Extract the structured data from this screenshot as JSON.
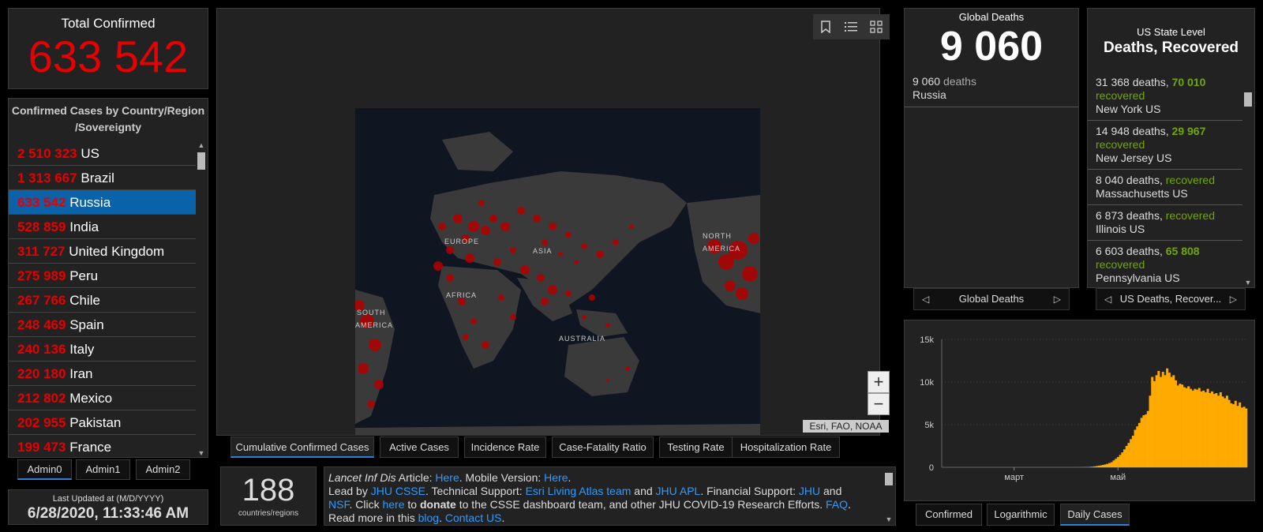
{
  "total": {
    "label": "Total Confirmed",
    "value": "633 542"
  },
  "countries": {
    "header": "Confirmed Cases by Country/Region /Sovereignty",
    "rows": [
      {
        "num": "2 510 323",
        "name": "US"
      },
      {
        "num": "1 313 667",
        "name": "Brazil"
      },
      {
        "num": "633 542",
        "name": "Russia"
      },
      {
        "num": "528 859",
        "name": "India"
      },
      {
        "num": "311 727",
        "name": "United Kingdom"
      },
      {
        "num": "275 989",
        "name": "Peru"
      },
      {
        "num": "267 766",
        "name": "Chile"
      },
      {
        "num": "248 469",
        "name": "Spain"
      },
      {
        "num": "240 136",
        "name": "Italy"
      },
      {
        "num": "220 180",
        "name": "Iran"
      },
      {
        "num": "212 802",
        "name": "Mexico"
      },
      {
        "num": "202 955",
        "name": "Pakistan"
      },
      {
        "num": "199 473",
        "name": "France"
      }
    ],
    "selected_index": 2
  },
  "admin_tabs": [
    "Admin0",
    "Admin1",
    "Admin2"
  ],
  "updated": {
    "label": "Last Updated at (M/D/YYYY)",
    "value": "6/28/2020, 11:33:46 AM"
  },
  "map": {
    "labels": [
      "EUROPE",
      "ASIA",
      "NORTH AMERICA",
      "AFRICA",
      "SOUTH AMERICA",
      "AUSTRALIA"
    ],
    "attribution": "Esri, FAO, NOAA",
    "tools": [
      "bookmark-icon",
      "legend-icon",
      "basemap-icon"
    ],
    "zoom_in": "+",
    "zoom_out": "−"
  },
  "map_tabs": [
    "Cumulative Confirmed Cases",
    "Active Cases",
    "Incidence Rate",
    "Case-Fatality Ratio",
    "Testing Rate",
    "Hospitalization Rate"
  ],
  "count": {
    "value": "188",
    "label": "countries/regions"
  },
  "info": {
    "line1_prefix": "Lancet Inf Dis",
    "line1_mid": " Article: ",
    "link_here1": "Here",
    "line1_mobile": ". Mobile Version: ",
    "link_here2": "Here",
    "line2_prefix": "Lead by ",
    "link_jhucsse": "JHU CSSE",
    "t_support": ". Technical Support: ",
    "link_esri": "Esri Living Atlas team",
    "t_and": " and ",
    "link_jhuapl": "JHU APL",
    "t_fin": ". Financial Support: ",
    "link_jhu": "JHU",
    "t_and2": " and",
    "link_nsf": "NSF",
    "t_click": ". Click ",
    "link_here3": "here",
    "t_to": " to ",
    "t_donate": "donate",
    "t_rest": " to the CSSE dashboard team, and other JHU COVID-19 Research Efforts. ",
    "link_faq": "FAQ",
    "t_read": ". Read more in this ",
    "link_blog": "blog",
    "t_dot": ". ",
    "link_contact": "Contact US",
    "t_end": "."
  },
  "global_deaths": {
    "label": "Global Deaths",
    "value": "9 060",
    "item_num": "9 060",
    "item_unit": "deaths",
    "item_country": "Russia",
    "pager": "Global Deaths"
  },
  "us_state": {
    "label": "US State Level",
    "value": "Deaths, Recovered",
    "rows": [
      {
        "deaths": "31 368 deaths, ",
        "recovered_num": "70 010",
        "recovered": "recovered",
        "place": "New York US"
      },
      {
        "deaths": "14 948 deaths, ",
        "recovered_num": "29 967",
        "recovered": "recovered",
        "place": "New Jersey US"
      },
      {
        "deaths": "8 040 deaths, ",
        "recovered_num": "",
        "recovered": "recovered",
        "place": "Massachusetts US"
      },
      {
        "deaths": "6 873 deaths, ",
        "recovered_num": "",
        "recovered": "recovered",
        "place": "Illinois US"
      },
      {
        "deaths": "6 603 deaths, ",
        "recovered_num": "65 808",
        "recovered": "recovered",
        "place": "Pennsylvania US"
      }
    ],
    "pager": "US Deaths, Recover..."
  },
  "chart_tabs": [
    "Confirmed",
    "Logarithmic",
    "Daily Cases"
  ],
  "colors": {
    "bar": "#ffaa00",
    "red": "#e60000",
    "green": "#70a800",
    "link": "#2f9aff",
    "selected": "#0a62a9"
  },
  "chart_data": {
    "type": "bar",
    "ylim": [
      0,
      15000
    ],
    "yticks": [
      "0",
      "5k",
      "10k",
      "15k"
    ],
    "xticks": [
      "март",
      "май"
    ],
    "series": [
      {
        "values": [
          0,
          0,
          0,
          0,
          0,
          0,
          0,
          0,
          0,
          0,
          0,
          0,
          0,
          0,
          0,
          0,
          0,
          0,
          0,
          0,
          0,
          0,
          0,
          0,
          0,
          0,
          0,
          0,
          0,
          0,
          0,
          0,
          0,
          0,
          0,
          0,
          0,
          0,
          0,
          0,
          0,
          0,
          0,
          0,
          0,
          0,
          0,
          0,
          0,
          0,
          0,
          0,
          0,
          0,
          0,
          0,
          0,
          0,
          0,
          0,
          0,
          2,
          3,
          4,
          6,
          10,
          15,
          20,
          30,
          50,
          70,
          100,
          140,
          180,
          220,
          270,
          330,
          400,
          500,
          600,
          800,
          1000,
          1200,
          1450,
          1750,
          2100,
          2500,
          2850,
          3300,
          3700,
          4400,
          4800,
          5200,
          5800,
          6100,
          6200,
          6600,
          8400,
          10600,
          10100,
          10800,
          11300,
          10600,
          11200,
          10800,
          11600,
          11100,
          10600,
          10800,
          10200,
          9600,
          9800,
          9700,
          9400,
          9300,
          9500,
          9200,
          9000,
          9200,
          9100,
          9300,
          8900,
          9000,
          8800,
          9200,
          8700,
          8900,
          8600,
          8700,
          8400,
          8800,
          8300,
          8100,
          8400,
          7900,
          7500,
          7400,
          7800,
          7200,
          7600,
          7000,
          7100,
          6900
        ]
      }
    ]
  }
}
